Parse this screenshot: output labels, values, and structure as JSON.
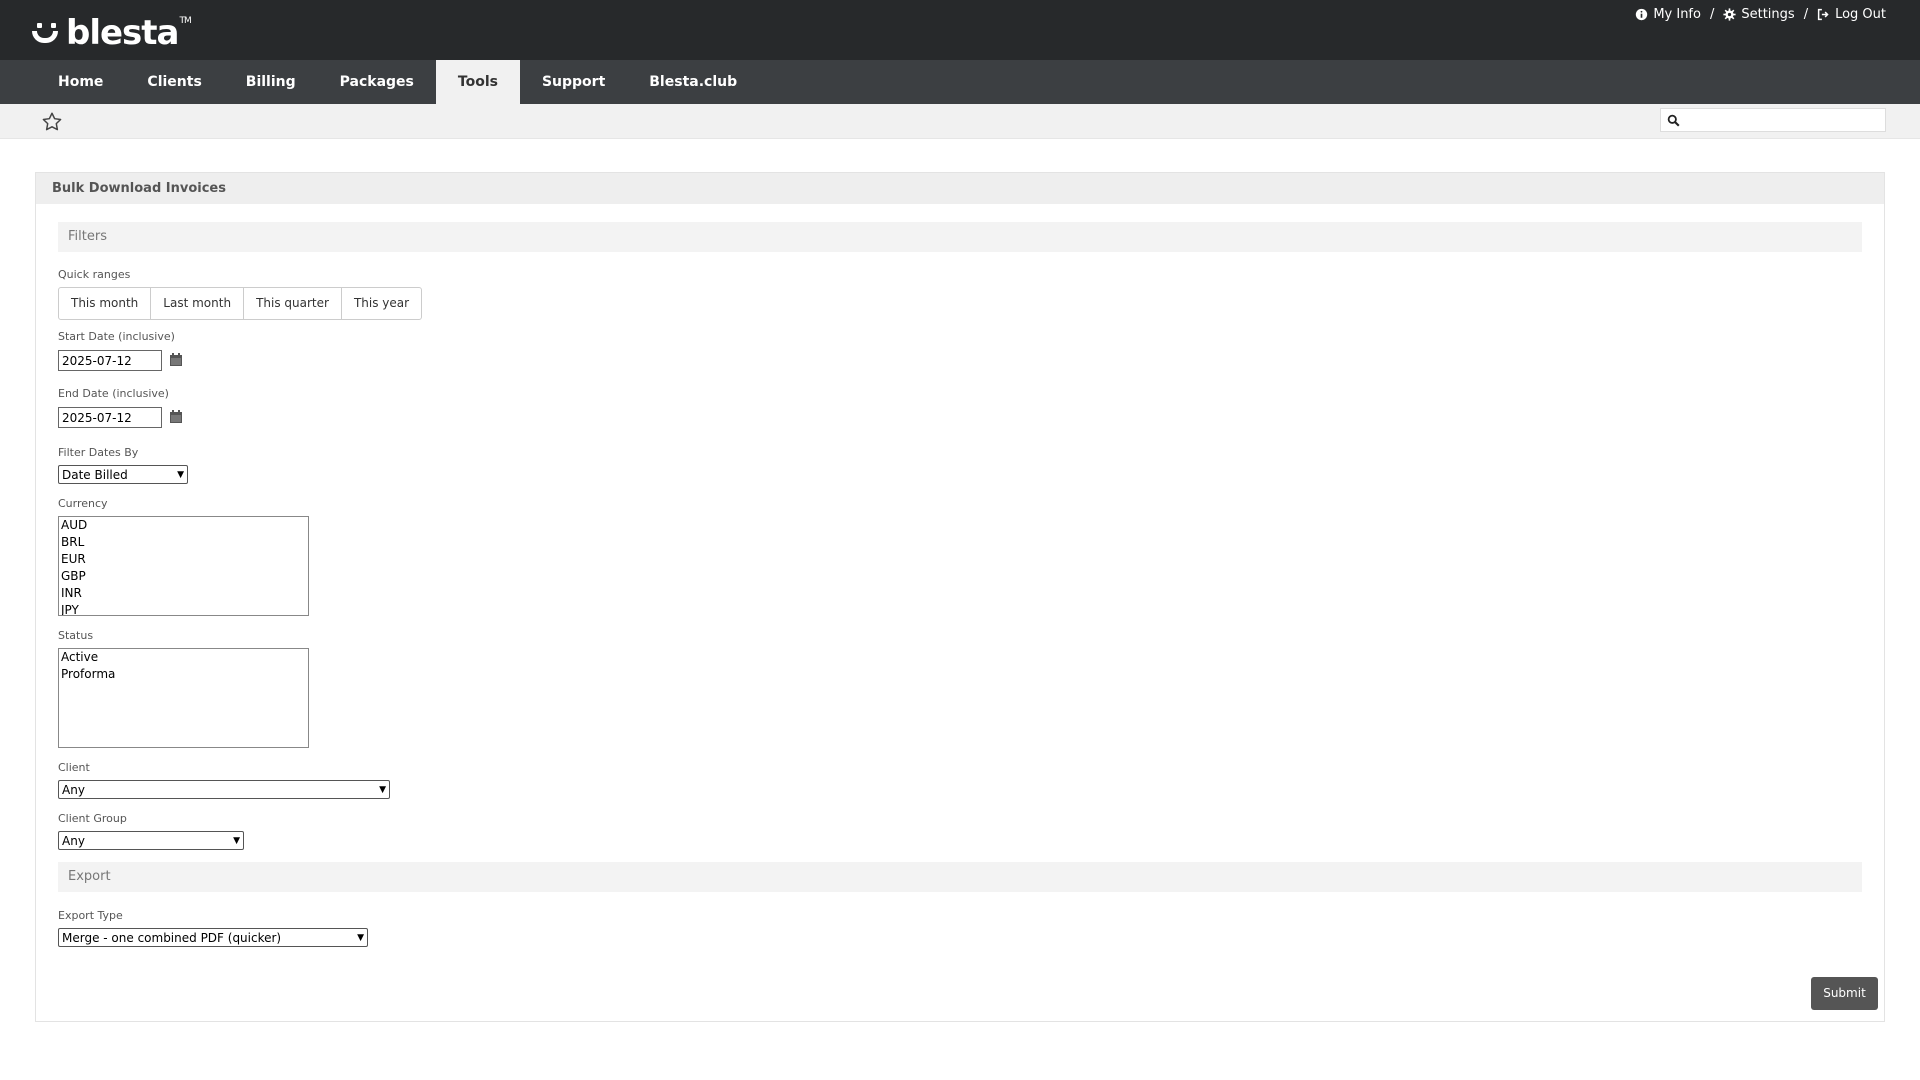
{
  "header": {
    "logo_text": "blesta",
    "logo_tm": "TM",
    "user_nav": [
      {
        "label": "My Info",
        "icon": "info-circle-icon"
      },
      {
        "label": "Settings",
        "icon": "gear-icon"
      },
      {
        "label": "Log Out",
        "icon": "sign-out-icon"
      }
    ],
    "separator": "/"
  },
  "nav": {
    "tabs": [
      "Home",
      "Clients",
      "Billing",
      "Packages",
      "Tools",
      "Support",
      "Blesta.club"
    ],
    "active": "Tools"
  },
  "subbar": {
    "search_value": ""
  },
  "panel": {
    "title": "Bulk Download Invoices",
    "filters_heading": "Filters",
    "quick_ranges_label": "Quick ranges",
    "quick_ranges": [
      "This month",
      "Last month",
      "This quarter",
      "This year"
    ],
    "start_date_label": "Start Date (inclusive)",
    "start_date": "2025-07-12",
    "end_date_label": "End Date (inclusive)",
    "end_date": "2025-07-12",
    "filter_dates_by_label": "Filter Dates By",
    "filter_dates_by": "Date Billed",
    "currency_label": "Currency",
    "currencies": [
      "AUD",
      "BRL",
      "EUR",
      "GBP",
      "INR",
      "JPY"
    ],
    "status_label": "Status",
    "statuses": [
      "Active",
      "Proforma"
    ],
    "client_label": "Client",
    "client": "Any",
    "client_group_label": "Client Group",
    "client_group": "Any",
    "export_heading": "Export",
    "export_type_label": "Export Type",
    "export_type": "Merge - one combined PDF (quicker)",
    "submit_label": "Submit"
  },
  "colors": {
    "topbar": "#27292b",
    "nav": "#3c3f42",
    "submit": "#555555"
  }
}
